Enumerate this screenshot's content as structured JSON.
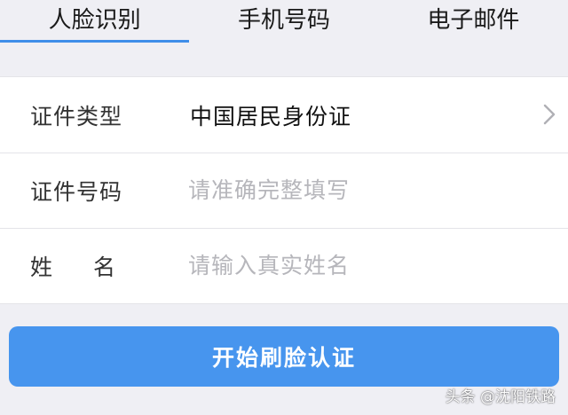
{
  "tabs": [
    {
      "label": "人脸识别",
      "active": true
    },
    {
      "label": "手机号码",
      "active": false
    },
    {
      "label": "电子邮件",
      "active": false
    }
  ],
  "form": {
    "id_type": {
      "label": "证件类型",
      "value": "中国居民身份证"
    },
    "id_number": {
      "label": "证件号码",
      "placeholder": "请准确完整填写",
      "value": ""
    },
    "name": {
      "label": "姓名",
      "placeholder": "请输入真实姓名",
      "value": ""
    }
  },
  "submit_button": {
    "label": "开始刷脸认证"
  },
  "watermark": "头条 @沈阳铁路",
  "colors": {
    "accent": "#3f8ee9",
    "button": "#4795ee",
    "background": "#efeff4",
    "placeholder": "#b6b6bb"
  },
  "icons": {
    "id_type_chevron": "chevron-right-icon"
  }
}
